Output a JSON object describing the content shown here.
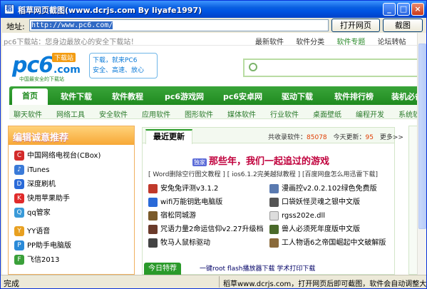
{
  "window": {
    "title": "稻草网页截图(www.dcrjs.com By liyafe1997)",
    "min": "_",
    "max": "□",
    "close": "×"
  },
  "address": {
    "label": "地址:",
    "url": "http://www.pc6.com/",
    "open_button": "打开网页",
    "capture_button": "截图"
  },
  "site": {
    "welcome": "pc6下载站：您身边最放心的安全下载站！",
    "toplinks": [
      "最新软件",
      "软件分类",
      "软件专题",
      "论坛转帖"
    ],
    "logo": {
      "main": "pc6",
      "com": ".com",
      "badge": "下载站",
      "sub": "中国最安全的下载站"
    },
    "slogan": [
      "下载，就来PC6",
      "安全、高速、放心"
    ],
    "nav": [
      "首页",
      "软件下载",
      "软件教程",
      "pc6游戏网",
      "pc6安卓网",
      "驱动下载",
      "软件排行榜",
      "装机必备"
    ],
    "subnav": [
      "聊天软件",
      "网络工具",
      "安全软件",
      "应用软件",
      "图形软件",
      "媒体软件",
      "行业软件",
      "桌面壁纸",
      "编程开发",
      "系统软件"
    ],
    "recommend": {
      "title": "编辑诚意推荐",
      "items": [
        {
          "label": "中国网络电视台(CBox)",
          "color": "#d32a2a"
        },
        {
          "label": "iTunes",
          "color": "#3a7ad8"
        },
        {
          "label": "深度刷机",
          "color": "#2a6ad8"
        },
        {
          "label": "快用苹果助手",
          "color": "#e02a2a"
        },
        {
          "label": "qq管家",
          "color": "#3a9ad8"
        },
        {
          "label": "YY语音",
          "color": "#e8a020"
        },
        {
          "label": "PP助手电脑版",
          "color": "#2a8ad8"
        },
        {
          "label": "飞信2013",
          "color": "#3aa03a"
        }
      ]
    },
    "latest": {
      "tab": "最近更新",
      "stats_prefix": "共收录软件：",
      "total": "85078",
      "today_prefix": "今天更新：",
      "today": "95",
      "more": "更多>>",
      "headline_tag": "独家",
      "headline": "那些年，我们一起追过的游戏",
      "links": "[ Word删除空行图文教程 ] [ ios6.1.2完美越狱教程 ] [百度网盘怎么用迅雷下载]",
      "software": [
        {
          "name": "安兔兔评测v3.1.2",
          "color": "#c0392b"
        },
        {
          "name": "漫画控v2.0.2.102绿色免费版",
          "color": "#5a7ab0"
        },
        {
          "name": "wifi万能钥匙电脑版",
          "color": "#2a6ad8"
        },
        {
          "name": "口袋妖怪灵魂之银中文版",
          "color": "#555"
        },
        {
          "name": "宿松同城游",
          "color": "#7a5a2a"
        },
        {
          "name": "rgss202e.dll",
          "color": "#ddd"
        },
        {
          "name": "咒语力量2命运信仰v2.27升级档",
          "color": "#6a3a2a"
        },
        {
          "name": "兽人必须死年度版中文版",
          "color": "#4a6a2a"
        },
        {
          "name": "牧马人鼠标驱动",
          "color": "#444"
        },
        {
          "name": "工人物语6之帝国崛起中文破解版",
          "color": "#8a6a3a"
        }
      ],
      "bottom_tab": "今日特荐",
      "bottom_links": "一键root  flash播放器下载  学术打印下载"
    }
  },
  "status": {
    "left": "完成",
    "right": "稻草www.dcrjs.com，打开网页后即可截图，软件会自动调整大小"
  }
}
